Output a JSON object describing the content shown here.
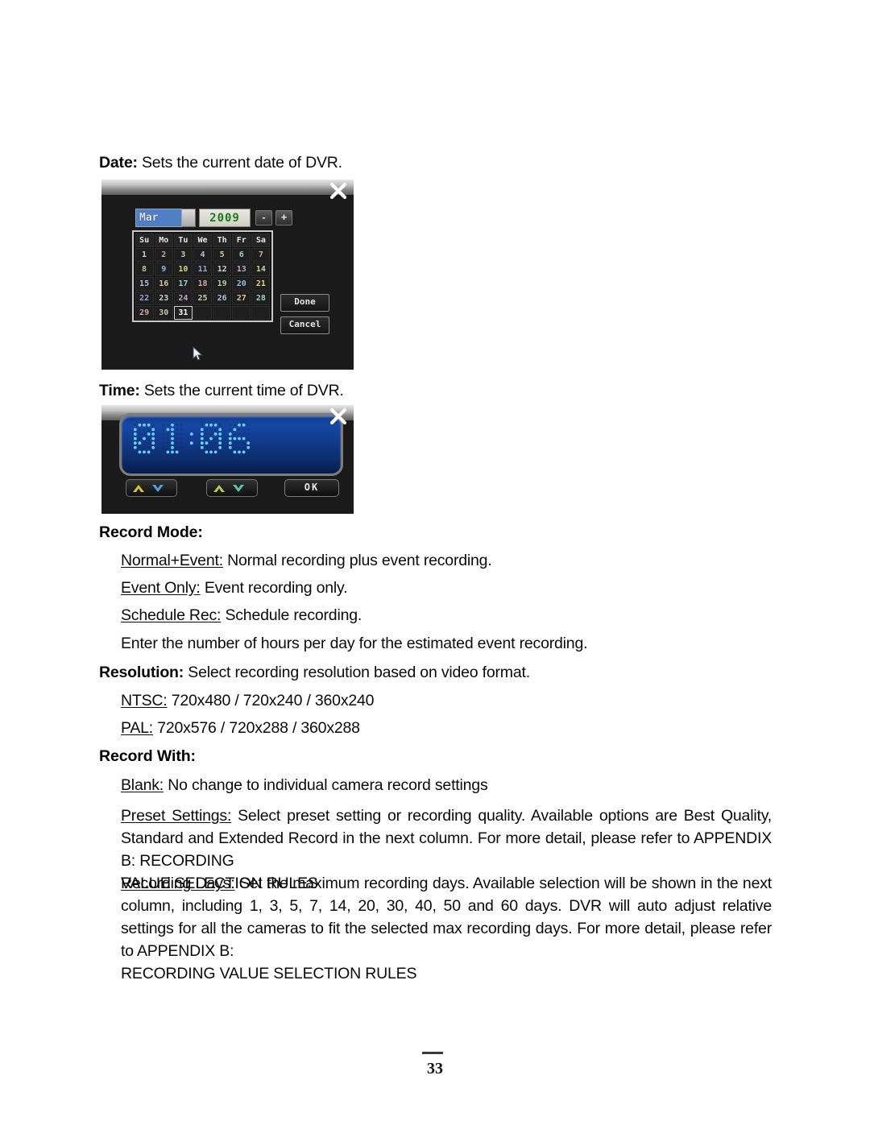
{
  "page": {
    "number": "33"
  },
  "sections": {
    "date": {
      "lead": "Date:",
      "text": " Sets the current date of DVR."
    },
    "time": {
      "lead": "Time:",
      "text": " Sets the current time of DVR."
    },
    "record_mode": {
      "heading": "Record Mode:",
      "items": [
        {
          "term": "Normal+Event:",
          "desc": " Normal recording plus event recording."
        },
        {
          "term": "Event Only:",
          "desc": " Event recording only."
        },
        {
          "term": "Schedule Rec:",
          "desc": " Schedule recording."
        }
      ],
      "note": "Enter the number of hours per day for the estimated event recording."
    },
    "resolution": {
      "lead": "Resolution:",
      "text": " Select recording resolution based on video format.",
      "items": [
        {
          "term": "NTSC:",
          "desc": " 720x480 / 720x240 / 360x240"
        },
        {
          "term": "PAL:",
          "desc": " 720x576 / 720x288 / 360x288"
        }
      ]
    },
    "record_with": {
      "heading": "Record With:",
      "blank": {
        "term": "Blank:",
        "desc": " No change to individual camera record settings"
      },
      "preset": {
        "term": "Preset Settings:",
        "desc": " Select preset setting or recording quality. Available options are Best Quality, Standard and Extended Record in the next column. For more detail, please refer to APPENDIX B:  RECORDING",
        "lastline": "VALUE SELECTION RULES"
      },
      "recording_days": {
        "term": "Recording Days:",
        "desc": " Set the maximum recording days. Available selection will be shown in the next column, including 1, 3, 5, 7, 14, 20, 30, 40, 50 and 60 days. DVR will auto adjust relative settings for all the cameras to fit the selected max recording days. For more detail, please refer to APPENDIX B:",
        "lastline": "RECORDING VALUE SELECTION RULES"
      }
    }
  },
  "date_dialog": {
    "month": "Mar",
    "year": "2009",
    "minus_label": "-",
    "plus_label": "+",
    "weekdays": [
      "Su",
      "Mo",
      "Tu",
      "We",
      "Th",
      "Fr",
      "Sa"
    ],
    "weeks": [
      [
        "1",
        "2",
        "3",
        "4",
        "5",
        "6",
        "7"
      ],
      [
        "8",
        "9",
        "10",
        "11",
        "12",
        "13",
        "14"
      ],
      [
        "15",
        "16",
        "17",
        "18",
        "19",
        "20",
        "21"
      ],
      [
        "22",
        "23",
        "24",
        "25",
        "26",
        "27",
        "28"
      ],
      [
        "29",
        "30",
        "31",
        "",
        "",
        "",
        ""
      ]
    ],
    "selected_day": "31",
    "done_label": "Done",
    "cancel_label": "Cancel",
    "accent_selected": "#ffffff",
    "month_highlight": "#4f7fc4",
    "year_color": "#1c7a1c"
  },
  "time_dialog": {
    "hours": "01",
    "minutes": "06",
    "separator": ":",
    "display_value": "01:06",
    "ok_label": "OK",
    "led_color": "#6fd4f5",
    "panel_color": "#1547a6"
  }
}
